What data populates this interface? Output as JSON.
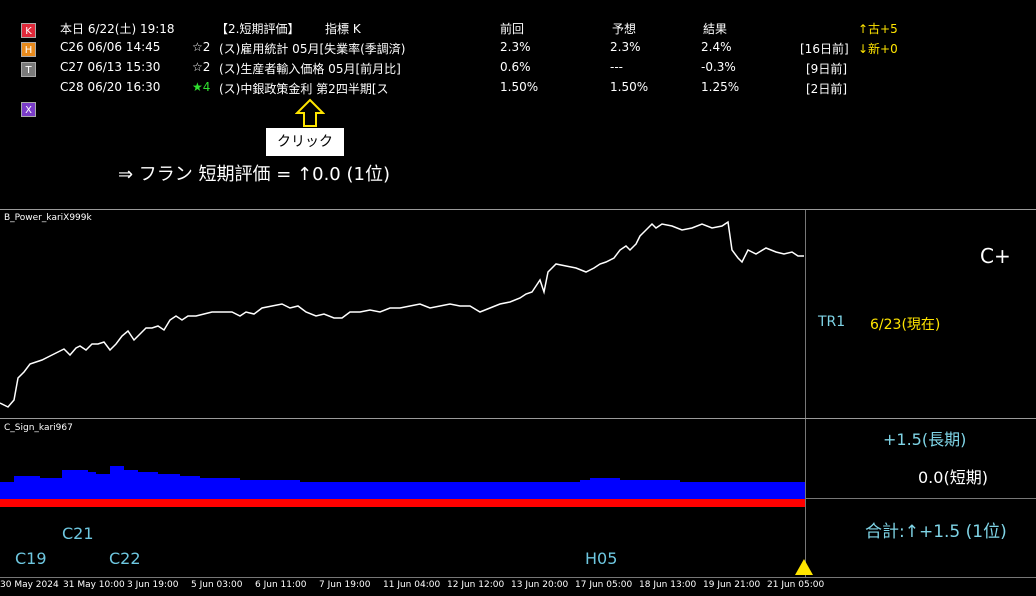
{
  "side_buttons": [
    {
      "label": "K",
      "color": "#e0293a"
    },
    {
      "label": "H",
      "color": "#e88a1c"
    },
    {
      "label": "T",
      "color": "#7a7a7a"
    },
    {
      "label": "X",
      "color": "#7a3cc8"
    }
  ],
  "header": {
    "date_label": "本日 6/22(土) 19:18",
    "category": "【2.短期評価】",
    "indicator": "指標 K",
    "col_prev": "前回",
    "col_forecast": "予想",
    "col_result": "結果",
    "up_count": "↑古+5",
    "down_count": "↓新+0"
  },
  "rows": [
    {
      "code": "C26 06/06 14:45",
      "star": "☆2",
      "name": "(ス)雇用統計 05月[失業率(季調済)",
      "prev": "2.3%",
      "forecast": "2.3%",
      "result": "2.4%",
      "ago": "[16日前]"
    },
    {
      "code": "C27 06/13 15:30",
      "star": "☆2",
      "name": "(ス)生産者輸入価格 05月[前月比]",
      "prev": "0.6%",
      "forecast": "---",
      "result": "-0.3%",
      "ago": "[9日前]"
    },
    {
      "code": "C28 06/20 16:30",
      "star": "★4",
      "name": "(ス)中銀政策金利 第2四半期[ス",
      "prev": "1.50%",
      "forecast": "1.50%",
      "result": "1.25%",
      "ago": "[2日前]"
    }
  ],
  "callout": "クリック",
  "summary": "⇒ フラン 短期評価 = ↑0.0 (1位)",
  "panel1": {
    "name": "B_Power_kariX999k",
    "grade": "C+",
    "tr_label": "TR1",
    "date_now": "6/23(現在)"
  },
  "panel2": {
    "name": "C_Sign_kari967",
    "long_term": "+1.5(長期)",
    "short_term": "0.0(短期)",
    "total": "合計:↑+1.5 (1位)"
  },
  "events": [
    {
      "label": "C21"
    },
    {
      "label": "C19"
    },
    {
      "label": "C22"
    },
    {
      "label": "H05"
    }
  ],
  "x_axis": [
    "30 May 2024",
    "31 May 10:00",
    "3 Jun 19:00",
    "5 Jun 03:00",
    "6 Jun 11:00",
    "7 Jun 19:00",
    "11 Jun 04:00",
    "12 Jun 12:00",
    "13 Jun 20:00",
    "17 Jun 05:00",
    "18 Jun 13:00",
    "19 Jun 21:00",
    "21 Jun 05:00"
  ]
}
